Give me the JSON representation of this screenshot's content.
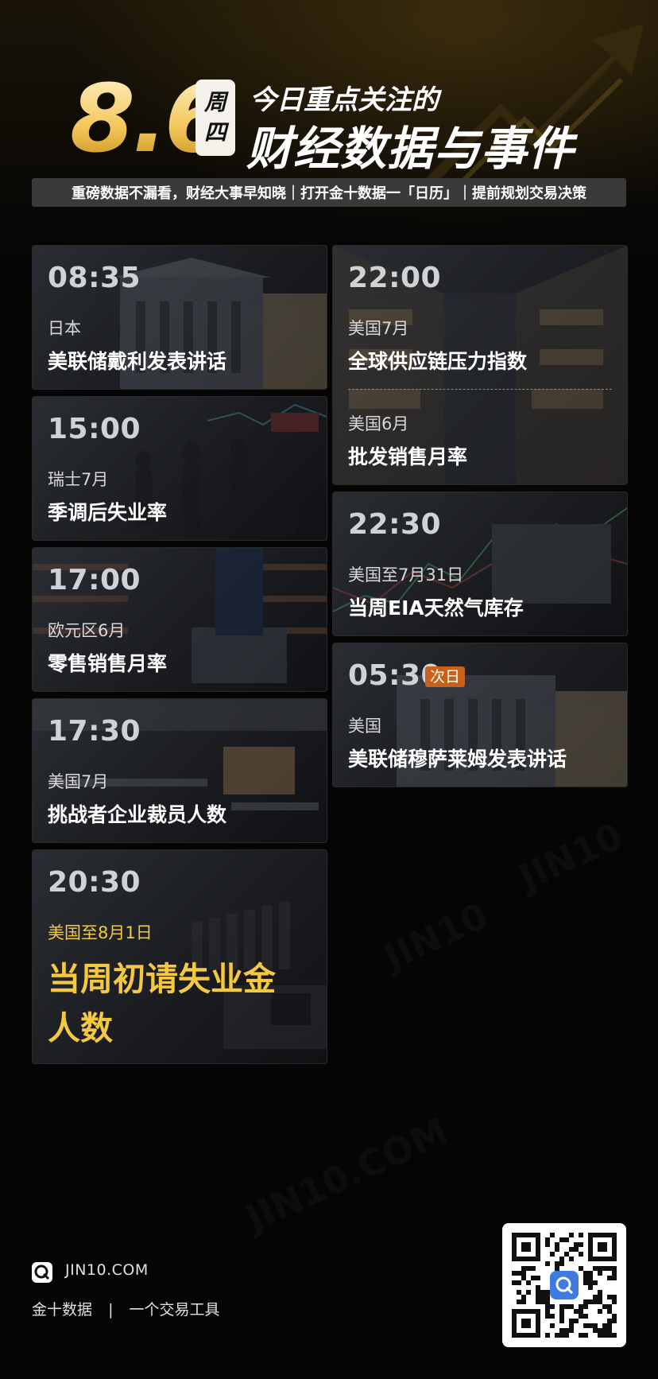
{
  "header": {
    "date": "8.6",
    "weekday_line1": "周",
    "weekday_line2": "四",
    "headline_small": "今日重点关注的",
    "headline_big": "财经数据与事件"
  },
  "tagline": "重磅数据不漏看，财经大事早知晓｜打开金十数据一「日历」｜提前规划交易决策",
  "left_cards": [
    {
      "time": "08:35",
      "region": "日本",
      "title": "美联储戴利发表讲话"
    },
    {
      "time": "15:00",
      "region": "瑞士7月",
      "title": "季调后失业率"
    },
    {
      "time": "17:00",
      "region": "欧元区6月",
      "title": "零售销售月率"
    },
    {
      "time": "17:30",
      "region": "美国7月",
      "title": "挑战者企业裁员人数"
    },
    {
      "time": "20:30",
      "region": "美国至8月1日",
      "title_line1": "当周初请失业金",
      "title_line2": "人数"
    }
  ],
  "right_cards": [
    {
      "time": "22:00",
      "region": "美国7月",
      "title": "全球供应链压力指数",
      "region2": "美国6月",
      "title2": "批发销售月率"
    },
    {
      "time": "22:30",
      "region": "美国至7月31日",
      "title": "当周EIA天然气库存"
    },
    {
      "time": "05:30",
      "badge": "次日",
      "region": "美国",
      "title": "美联储穆萨莱姆发表讲话"
    }
  ],
  "footer": {
    "site": "JIN10.COM",
    "brand": "金十数据",
    "slogan": "一个交易工具"
  },
  "colors": {
    "accent_gold": "#f3c65a",
    "highlight_text": "#f5c842",
    "badge": "#c8611b"
  }
}
